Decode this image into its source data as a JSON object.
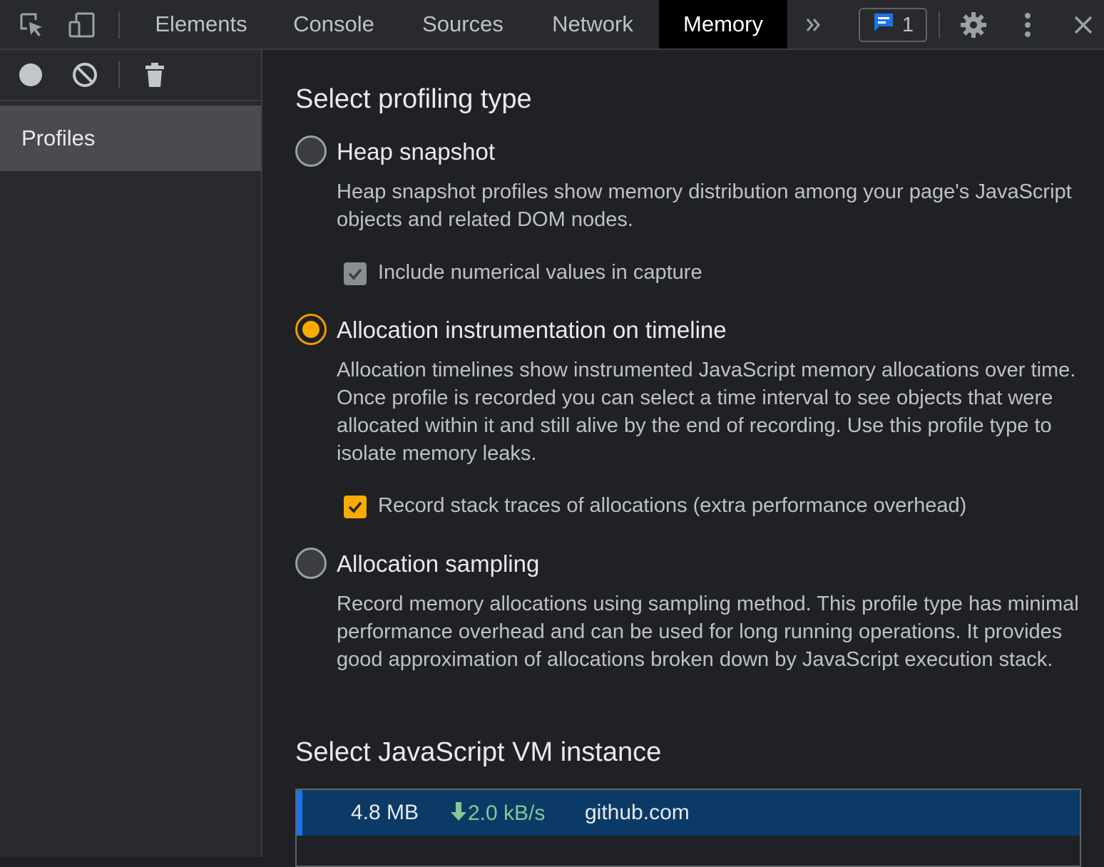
{
  "toolbar": {
    "tabs": [
      "Elements",
      "Console",
      "Sources",
      "Network",
      "Memory"
    ],
    "active_tab": "Memory",
    "more_tabs_icon": "chevrons-right-icon",
    "issues_count": "1"
  },
  "sidebar": {
    "profiles_label": "Profiles"
  },
  "main": {
    "profiling_title": "Select profiling type",
    "options": [
      {
        "label": "Heap snapshot",
        "selected": false,
        "description": "Heap snapshot profiles show memory distribution among your page's JavaScript objects and related DOM nodes.",
        "checkbox_label": "Include numerical values in capture",
        "checkbox_checked": true,
        "checkbox_disabled": true
      },
      {
        "label": "Allocation instrumentation on timeline",
        "selected": true,
        "description": "Allocation timelines show instrumented JavaScript memory allocations over time. Once profile is recorded you can select a time interval to see objects that were allocated within it and still alive by the end of recording. Use this profile type to isolate memory leaks.",
        "checkbox_label": "Record stack traces of allocations (extra performance overhead)",
        "checkbox_checked": true,
        "checkbox_disabled": false
      },
      {
        "label": "Allocation sampling",
        "selected": false,
        "description": "Record memory allocations using sampling method. This profile type has minimal performance overhead and can be used for long running operations. It provides good approximation of allocations broken down by JavaScript execution stack."
      }
    ],
    "vm_title": "Select JavaScript VM instance",
    "vm_instance": {
      "size": "4.8 MB",
      "rate": "2.0 kB/s",
      "url": "github.com"
    }
  },
  "colors": {
    "accent": "#f9ab00",
    "selected_row": "#0b3a66",
    "rate_green": "#81c995"
  }
}
